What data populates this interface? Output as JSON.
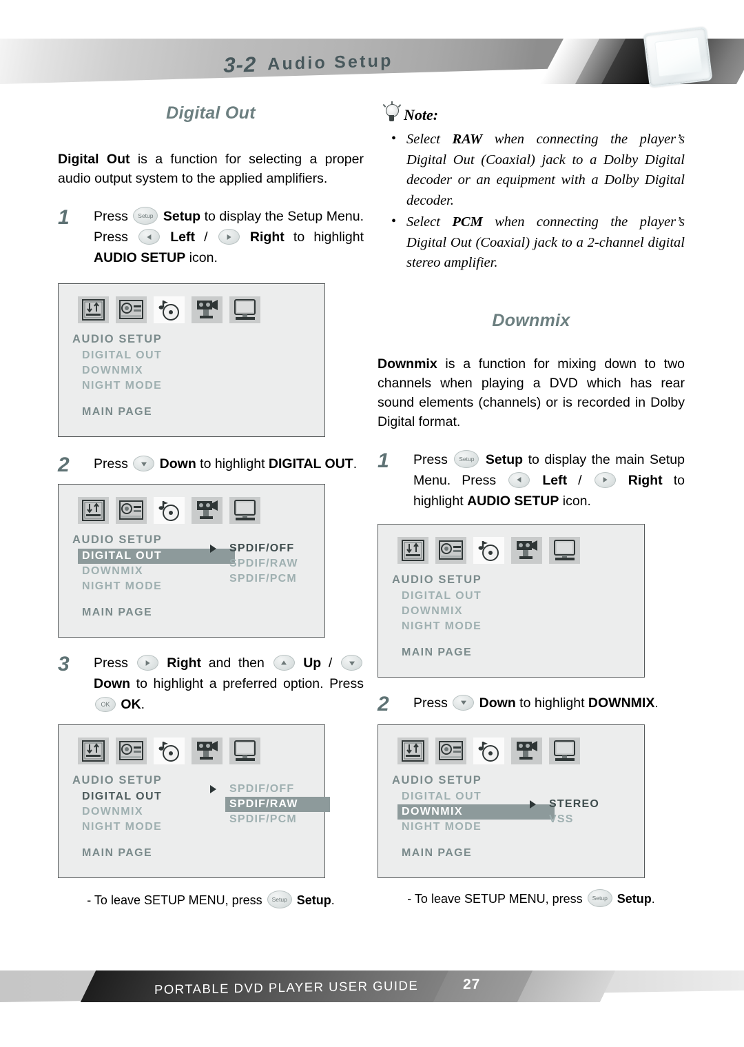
{
  "header": {
    "section_number": "3-2",
    "section_title": "Audio Setup",
    "device_icon": "portable-dvd-player-icon"
  },
  "left_column": {
    "heading": "Digital Out",
    "intro_bold": "Digital Out",
    "intro_rest": " is a function for selecting a proper audio output system to the applied amplifiers.",
    "steps": [
      {
        "number": "1",
        "parts": [
          {
            "t": "text",
            "v": "Press "
          },
          {
            "t": "key",
            "v": "Setup"
          },
          {
            "t": "bold",
            "v": " Setup"
          },
          {
            "t": "text",
            "v": " to display the Setup Menu. Press "
          },
          {
            "t": "key",
            "v": "left"
          },
          {
            "t": "bold",
            "v": " Left"
          },
          {
            "t": "text",
            "v": " / "
          },
          {
            "t": "key",
            "v": "right"
          },
          {
            "t": "bold",
            "v": " Right"
          },
          {
            "t": "text",
            "v": " to highlight "
          },
          {
            "t": "bold",
            "v": "AUDIO SETUP"
          },
          {
            "t": "text",
            "v": " icon."
          }
        ]
      },
      {
        "number": "2",
        "parts": [
          {
            "t": "text",
            "v": "Press "
          },
          {
            "t": "key",
            "v": "down"
          },
          {
            "t": "bold",
            "v": " Down"
          },
          {
            "t": "text",
            "v": " to highlight "
          },
          {
            "t": "bold",
            "v": "DIGITAL OUT"
          },
          {
            "t": "text",
            "v": "."
          }
        ]
      },
      {
        "number": "3",
        "parts": [
          {
            "t": "text",
            "v": "Press "
          },
          {
            "t": "key",
            "v": "right"
          },
          {
            "t": "bold",
            "v": " Right"
          },
          {
            "t": "text",
            "v": " and then "
          },
          {
            "t": "key",
            "v": "up"
          },
          {
            "t": "bold",
            "v": " Up"
          },
          {
            "t": "text",
            "v": " / "
          },
          {
            "t": "key",
            "v": "down"
          },
          {
            "t": "bold",
            "v": " Down"
          },
          {
            "t": "text",
            "v": " to highlight a preferred option. Press "
          },
          {
            "t": "key",
            "v": "OK"
          },
          {
            "t": "bold",
            "v": " OK"
          },
          {
            "t": "text",
            "v": "."
          }
        ]
      }
    ],
    "leave_note": {
      "prefix": "- To leave SETUP MENU, press ",
      "key": "Setup",
      "bold": "Setup",
      "suffix": "."
    }
  },
  "note": {
    "icon": "lightbulb-icon",
    "title": "Note:",
    "items": [
      {
        "pre": "Select ",
        "bold": "RAW",
        "post": " when connecting the player’s Digital Out (Coaxial) jack to a Dolby Digital decoder or an equipment with a Dolby Digital decoder."
      },
      {
        "pre": "Select ",
        "bold": "PCM",
        "post": " when connecting the player’s Digital Out (Coaxial) jack to a 2-channel digital stereo amplifier."
      }
    ]
  },
  "right_column": {
    "heading": "Downmix",
    "intro_bold": "Downmix",
    "intro_rest": " is a function for mixing down to two channels when playing a DVD which has rear sound elements (channels) or is recorded in Dolby Digital format.",
    "steps": [
      {
        "number": "1",
        "parts": [
          {
            "t": "text",
            "v": "Press "
          },
          {
            "t": "key",
            "v": "Setup"
          },
          {
            "t": "bold",
            "v": " Setup"
          },
          {
            "t": "text",
            "v": " to display the main Setup Menu. Press "
          },
          {
            "t": "key",
            "v": "left"
          },
          {
            "t": "bold",
            "v": " Left"
          },
          {
            "t": "text",
            "v": " / "
          },
          {
            "t": "key",
            "v": "right"
          },
          {
            "t": "bold",
            "v": " Right"
          },
          {
            "t": "text",
            "v": " to highlight "
          },
          {
            "t": "bold",
            "v": "AUDIO SETUP"
          },
          {
            "t": "text",
            "v": " icon."
          }
        ]
      },
      {
        "number": "2",
        "parts": [
          {
            "t": "text",
            "v": "Press "
          },
          {
            "t": "key",
            "v": "down"
          },
          {
            "t": "bold",
            "v": " Down"
          },
          {
            "t": "text",
            "v": " to highlight "
          },
          {
            "t": "bold",
            "v": "DOWNMIX"
          },
          {
            "t": "text",
            "v": "."
          }
        ]
      }
    ],
    "leave_note": {
      "prefix": "- To leave SETUP MENU, press ",
      "key": "Setup",
      "bold": "Setup",
      "suffix": "."
    }
  },
  "osd": {
    "icon_names": [
      "general-setup-icon",
      "speaker-setup-icon",
      "audio-setup-icon",
      "video-setup-icon",
      "display-setup-icon"
    ],
    "selected_icon_index": 2,
    "title": "AUDIO SETUP",
    "items": [
      "DIGITAL OUT",
      "DOWNMIX",
      "NIGHT MODE"
    ],
    "main_page": "MAIN PAGE",
    "screens": [
      {
        "name": "audio-setup-screen-1",
        "highlighted_item": null,
        "dark_item": null,
        "options": [],
        "highlighted_option": null,
        "dark_option": null
      },
      {
        "name": "digital-out-screen-highlight",
        "highlighted_item": "DIGITAL OUT",
        "dark_item": null,
        "options": [
          "SPDIF/OFF",
          "SPDIF/RAW",
          "SPDIF/PCM"
        ],
        "highlighted_option": null,
        "dark_option": "SPDIF/OFF"
      },
      {
        "name": "digital-out-screen-raw-selected",
        "highlighted_item": null,
        "dark_item": "DIGITAL OUT",
        "options": [
          "SPDIF/OFF",
          "SPDIF/RAW",
          "SPDIF/PCM"
        ],
        "highlighted_option": "SPDIF/RAW",
        "dark_option": null
      },
      {
        "name": "audio-setup-screen-2",
        "highlighted_item": null,
        "dark_item": null,
        "options": [],
        "highlighted_option": null,
        "dark_option": null
      },
      {
        "name": "downmix-screen-highlight",
        "highlighted_item": "DOWNMIX",
        "dark_item": null,
        "options": [
          "STEREO",
          "VSS"
        ],
        "highlighted_option": null,
        "dark_option": "STEREO"
      }
    ]
  },
  "footer": {
    "title": "PORTABLE DVD PLAYER USER GUIDE",
    "page": "27"
  },
  "colors": {
    "heading": "#6c7f80",
    "step_number": "#5e7274",
    "osd_background": "#eceded",
    "osd_highlight": "#8d9a9b",
    "osd_text": "#9fb0b1",
    "osd_title": "#7b8b8c"
  }
}
